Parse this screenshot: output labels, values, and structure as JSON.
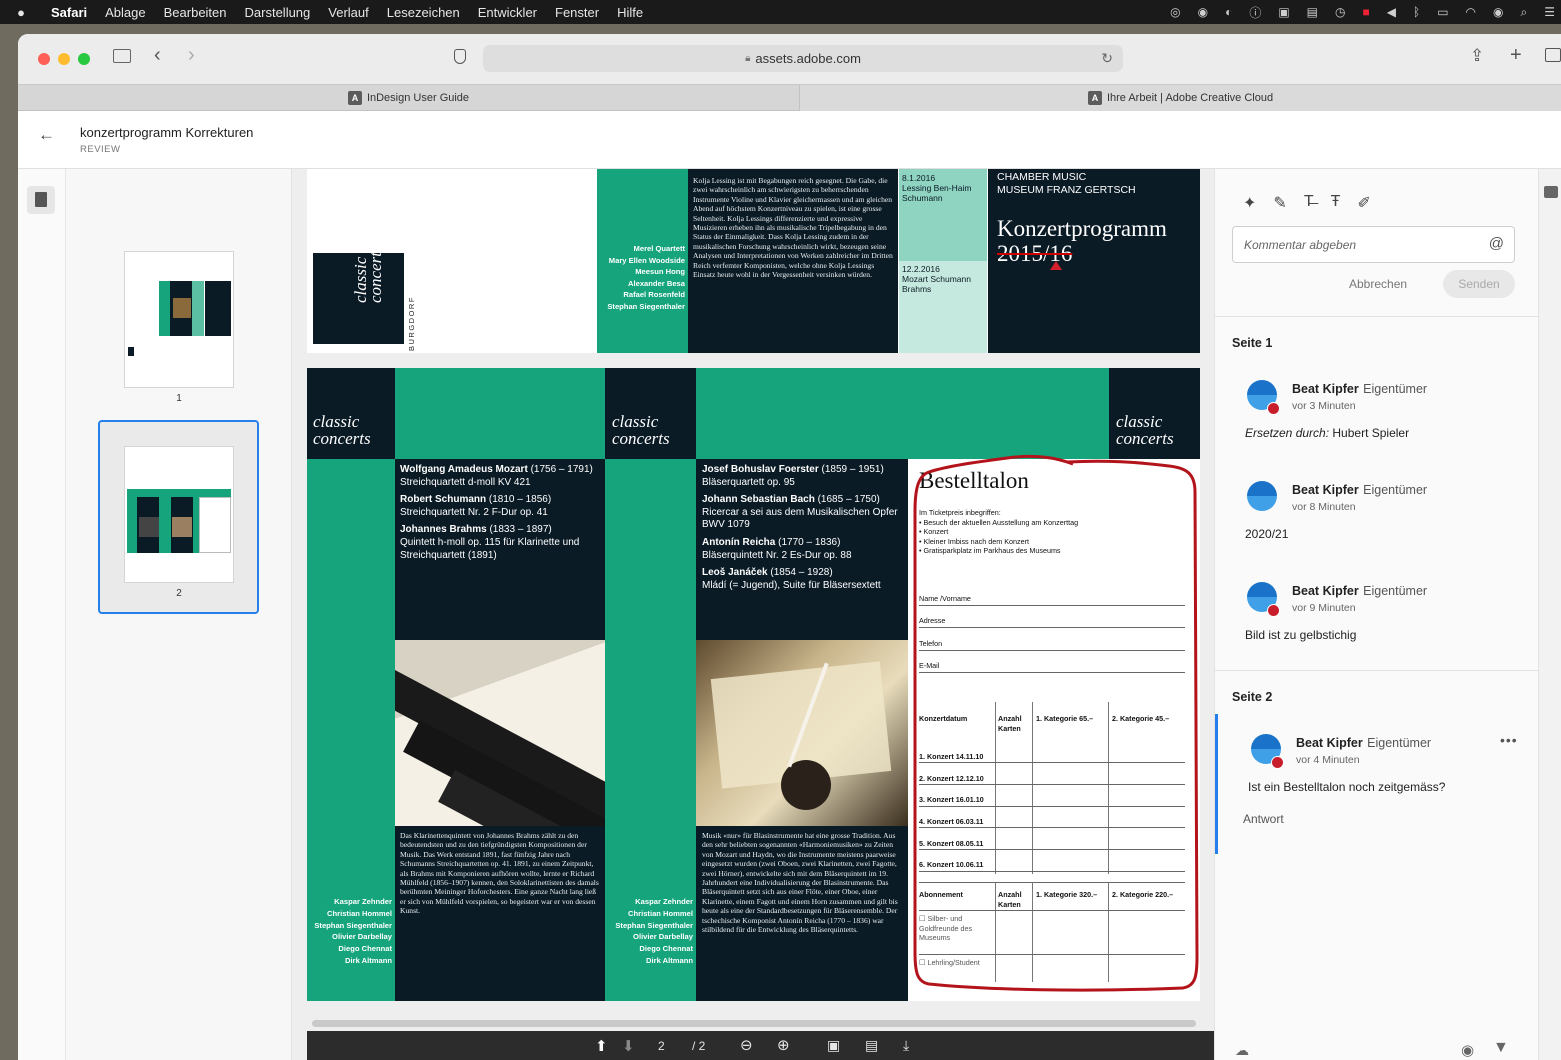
{
  "menubar": {
    "items": [
      "Safari",
      "Ablage",
      "Bearbeiten",
      "Darstellung",
      "Verlauf",
      "Lesezeichen",
      "Entwickler",
      "Fenster",
      "Hilfe"
    ]
  },
  "browser": {
    "url": "assets.adobe.com",
    "tabs": [
      {
        "label": "InDesign User Guide"
      },
      {
        "label": "Ihre Arbeit | Adobe Creative Cloud"
      }
    ]
  },
  "review": {
    "title": "konzertprogramm Korrekturen",
    "subtitle": "REVIEW"
  },
  "thumbnails": [
    {
      "label": "1",
      "selected": false
    },
    {
      "label": "2",
      "selected": true
    }
  ],
  "doc": {
    "page1": {
      "musicians": [
        "Merel Quartett",
        "Mary Ellen Woodside",
        "Meesun Hong",
        "Alexander Besa",
        "Rafael Rosenfeld",
        "Stephan Siegenthaler"
      ],
      "bio": "Kolja Lessing ist mit Begabungen reich gesegnet. Die Gabe, die zwei wahrscheinlich am schwierigsten zu beherrschenden Instrumente Violine und Klavier gleichermassen und am gleichen Abend auf höchstem Konzertniveau zu spielen, ist eine grosse Seltenheit. Kolja Lessings differenzierte und expressive Musizieren erheben ihn als musikalische Tripelbegabung in den Status der Einmaligkeit. Dass Kolja Lessing zudem in der musikalischen Forschung wahrscheinlich wirkt, bezeugen seine Analysen und Interpretationen von Werken zahlreicher im Dritten Reich verfemter Komponisten, welche ohne Kolja Lessings Einsatz heute wohl in der Vergessenheit versinken würden.",
      "date1": "8.1.2016",
      "date1_text": "Lessing Ben-Haim Schumann",
      "date2": "12.2.2016",
      "date2_text": "Mozart Schumann Brahms",
      "venue": "CHAMBER MUSIC\nMUSEUM FRANZ GERTSCH",
      "program_title": "Konzertprogramm",
      "program_year": "2015/16",
      "logo_line1": "classic",
      "logo_line2": "concerts",
      "logo_place": "BURGDORF"
    },
    "page2": {
      "cc1": "classic",
      "cc2": "concerts",
      "col1": [
        {
          "composer": "Wolfgang Amadeus Mozart",
          "years": " (1756 – 1791)",
          "work": "Streichquartett d-moll KV 421"
        },
        {
          "composer": "Robert Schumann",
          "years": " (1810 – 1856)",
          "work": "Streichquartett Nr. 2 F-Dur op. 41"
        },
        {
          "composer": "Johannes Brahms",
          "years": " (1833 – 1897)",
          "work": "Quintett h-moll op. 115 für Klarinette und Streichquartett (1891)"
        }
      ],
      "col2": [
        {
          "composer": "Josef Bohuslav Foerster",
          "years": " (1859 – 1951)",
          "work": "Bläserquartett op. 95"
        },
        {
          "composer": "Johann Sebastian Bach",
          "years": " (1685 – 1750)",
          "work": "Ricercar a sei aus dem Musikalischen Opfer BWV 1079"
        },
        {
          "composer": "Antonín Reicha",
          "years": " (1770 – 1836)",
          "work": "Bläserquintett Nr. 2 Es-Dur op. 88"
        },
        {
          "composer": "Leoš Janáček",
          "years": " (1854 – 1928)",
          "work": "Mládí (= Jugend), Suite für Bläsersextett"
        }
      ],
      "text1": "Das Klarinettenquintett von Johannes Brahms zählt zu den bedeutendsten und zu den tiefgründigsten Kompositionen der Musik. Das Werk entstand 1891, fast fünfzig Jahre nach Schumanns Streichquartetten op. 41. 1891, zu einem Zeitpunkt, als Brahms mit Komponieren aufhören wollte, lernte er Richard Mühlfeld (1856–1907) kennen, den Soloklarinettisten des damals berühmten Meininger Hoforchesters. Eine ganze Nacht lang ließ er sich von Mühlfeld vorspielen, so begeistert war er von dessen Kunst.",
      "text2": "Musik «nur» für Blasinstrumente hat eine grosse Tradition. Aus den sehr beliebten sogenannten «Harmoniemusiken» zu Zeiten von Mozart und Haydn, wo die Instrumente meistens paarweise eingesetzt wurden (zwei Oboen, zwei Klarinetten, zwei Fagotte, zwei Hörner), entwickelte sich mit dem Bläserquintett im 19. Jahrhundert eine Individualisierung der Blasinstrumente. Das Bläserquintett setzt sich aus einer Flöte, einer Oboe, einer Klarinette, einem Fagott und einem Horn zusammen und gilt bis heute als eine der Standardbesetzungen für Bläserensemble. Der tschechische Komponist Antonín Reicha (1770 – 1836) war stilbildend für die Entwicklung des Bläserquintetts.",
      "names1": [
        "Kaspar Zehnder",
        "Christian Hommel",
        "Stephan Siegenthaler",
        "Olivier Darbellay",
        "Diego Chennat",
        "Dirk Altmann"
      ],
      "names2": [
        "Kaspar Zehnder",
        "Christian Hommel",
        "Stephan Siegenthaler",
        "Olivier Darbellay",
        "Diego Chennat",
        "Dirk Altmann"
      ],
      "form": {
        "title": "Bestelltalon",
        "intro": "Im Ticketpreis inbegriffen:",
        "bullets": [
          "• Besuch der aktuellen Ausstellung am Konzerttag",
          "• Konzert",
          "• Kleiner Imbiss nach dem Konzert",
          "• Gratisparkplatz im Parkhaus des Museums"
        ],
        "fields": [
          "Name /Vorname",
          "Adresse",
          "Telefon",
          "E-Mail"
        ],
        "table1_headers": [
          "Konzertdatum",
          "Anzahl Karten",
          "1. Kategorie 65.–",
          "2. Kategorie 45.–"
        ],
        "concerts": [
          "1. Konzert 14.11.10",
          "2. Konzert 12.12.10",
          "3. Konzert 16.01.10",
          "4. Konzert 06.03.11",
          "5. Konzert 08.05.11",
          "6. Konzert 10.06.11"
        ],
        "table2_headers": [
          "Abonnement",
          "Anzahl Karten",
          "1. Kategorie 320.–",
          "2. Kategorie 220.–"
        ],
        "abo_options": [
          "☐ Silber- und Goldfreunde des Museums",
          "☐ Lehrling/Student"
        ]
      }
    }
  },
  "comments": {
    "placeholder": "Kommentar abgeben",
    "cancel": "Abbrechen",
    "send": "Senden",
    "sections": [
      {
        "title": "Seite 1",
        "items": [
          {
            "author": "Beat Kipfer",
            "role": "Eigentümer",
            "time": "vor 3 Minuten",
            "prefix": "Ersetzen durch:",
            "body": " Hubert Spieler"
          },
          {
            "author": "Beat Kipfer",
            "role": "Eigentümer",
            "time": "vor 8 Minuten",
            "prefix": "",
            "body": "2020/21"
          },
          {
            "author": "Beat Kipfer",
            "role": "Eigentümer",
            "time": "vor 9 Minuten",
            "prefix": "",
            "body": "Bild ist zu gelbstichig"
          }
        ]
      },
      {
        "title": "Seite 2",
        "items": [
          {
            "author": "Beat Kipfer",
            "role": "Eigentümer",
            "time": "vor 4 Minuten",
            "prefix": "",
            "body": "Ist ein Bestelltalon noch zeitgemäss?",
            "reply": "Antwort"
          }
        ]
      }
    ]
  },
  "pager": {
    "current": "2",
    "total": "/ 2"
  }
}
